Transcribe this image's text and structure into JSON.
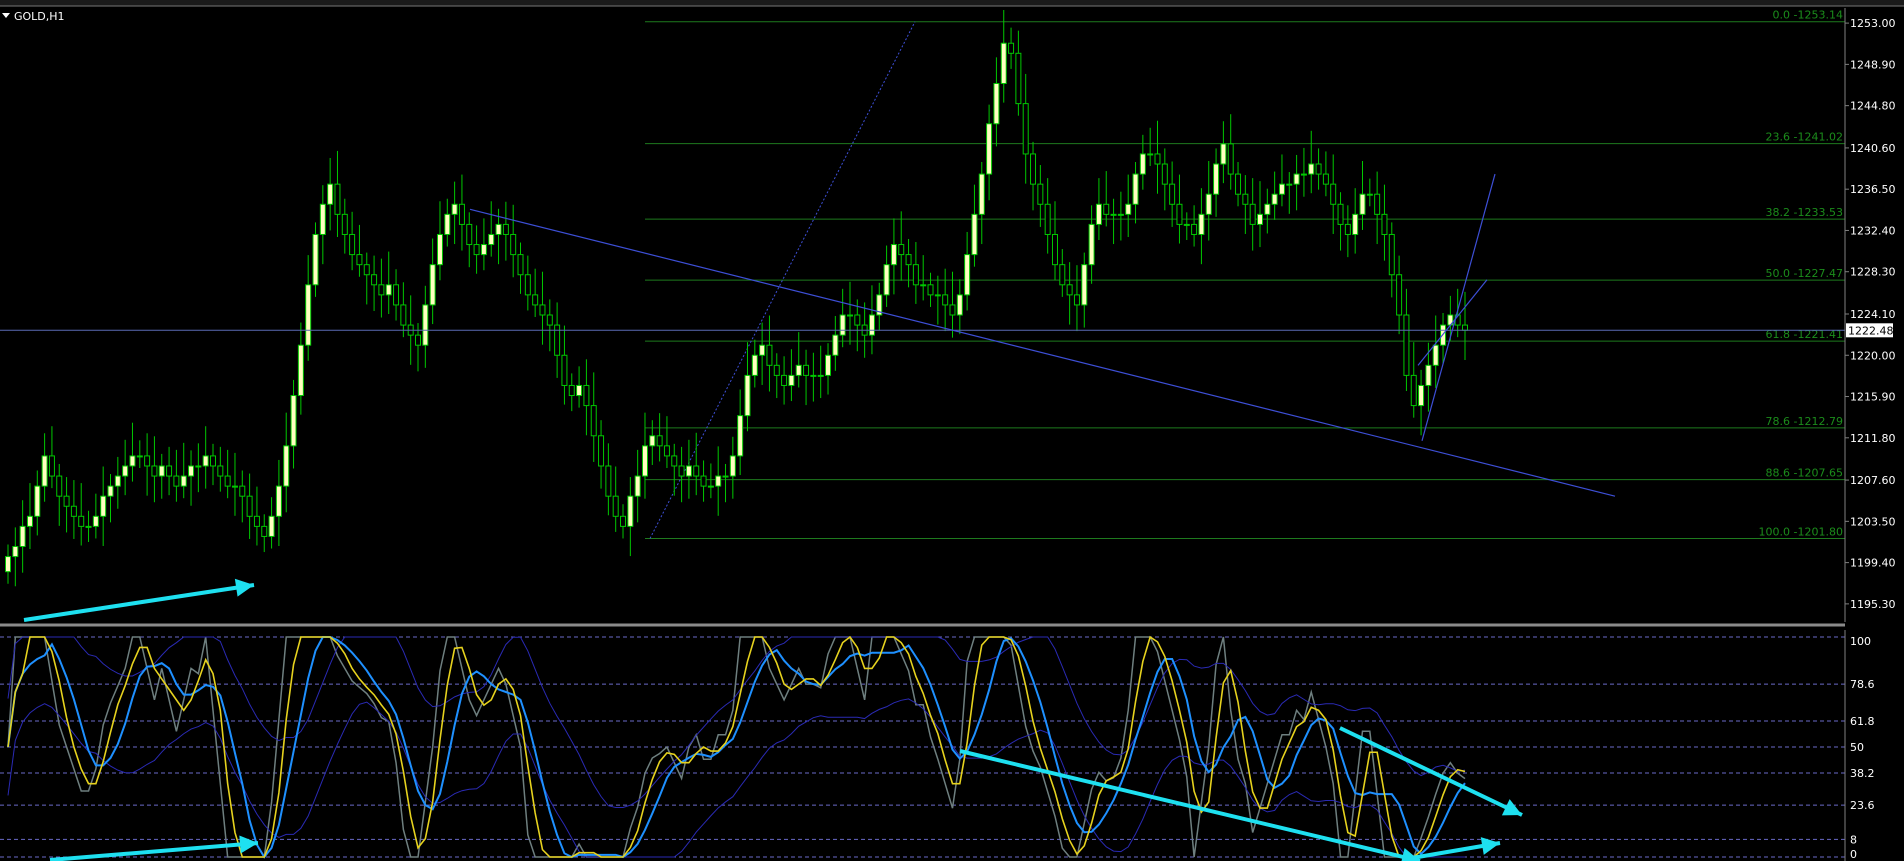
{
  "window": {
    "symbol_timeframe": "GOLD,H1"
  },
  "colors": {
    "background": "#000000",
    "bull_candle": "#ffffc0",
    "bear_candle": "#000000",
    "wick": "#00c800",
    "fib_line": "#1e7a1e",
    "fib_text": "#1b8c1b",
    "trendline": "#3d4fd6",
    "annotation_arrow": "#1ee0f0",
    "osc_main": "#e6d21e",
    "osc_signal": "#1e90ff",
    "osc_grey": "#6e7f7f",
    "osc_band": "#2a2ab4",
    "level_line": "#6a6ac8",
    "price_tag_bg": "#ffffff"
  },
  "chart_data": [
    {
      "type": "candlestick",
      "title": "GOLD,H1",
      "ylim": [
        1193.5,
        1254.5
      ],
      "y_ticks": [
        "1253.00",
        "1248.90",
        "1244.80",
        "1240.60",
        "1236.50",
        "1232.40",
        "1228.30",
        "1224.10",
        "1220.00",
        "1215.90",
        "1211.80",
        "1207.60",
        "1203.50",
        "1199.40",
        "1195.30"
      ],
      "current_price": "1222.48",
      "fibonacci_levels": [
        {
          "label": "0.0 -1253.14",
          "price": 1253.14
        },
        {
          "label": "23.6 -1241.02",
          "price": 1241.02
        },
        {
          "label": "38.2 -1233.53",
          "price": 1233.53
        },
        {
          "label": "50.0 -1227.47",
          "price": 1227.47
        },
        {
          "label": "61.8 -1221.41",
          "price": 1221.41
        },
        {
          "label": "78.6 -1212.79",
          "price": 1212.79
        },
        {
          "label": "88.6 -1207.65",
          "price": 1207.65
        },
        {
          "label": "100.0 -1201.80",
          "price": 1201.8
        }
      ],
      "closes": [
        1200,
        1201,
        1203,
        1204,
        1207,
        1210,
        1208,
        1206,
        1205,
        1204,
        1203,
        1203,
        1204,
        1206,
        1207,
        1208,
        1209,
        1210,
        1210,
        1209,
        1208,
        1209,
        1208,
        1207,
        1208,
        1209,
        1209,
        1210,
        1209,
        1208,
        1207,
        1207,
        1206,
        1204,
        1203,
        1202,
        1204,
        1207,
        1211,
        1216,
        1221,
        1227,
        1232,
        1235,
        1237,
        1234,
        1232,
        1230,
        1229,
        1228,
        1227,
        1226,
        1227,
        1225,
        1223,
        1222,
        1221,
        1225,
        1229,
        1232,
        1234,
        1235,
        1233,
        1231,
        1230,
        1231,
        1232,
        1233,
        1232,
        1230,
        1228,
        1226,
        1225,
        1224,
        1223,
        1220,
        1217,
        1216,
        1217,
        1215,
        1212,
        1209,
        1206,
        1204,
        1203,
        1206,
        1208,
        1211,
        1212,
        1211,
        1210,
        1209,
        1208,
        1209,
        1208,
        1207,
        1207,
        1208,
        1208,
        1210,
        1214,
        1218,
        1220,
        1221,
        1219,
        1218,
        1217,
        1218,
        1219,
        1218,
        1218,
        1218,
        1220,
        1222,
        1224,
        1224,
        1223,
        1222,
        1224,
        1226,
        1229,
        1231,
        1230,
        1229,
        1227,
        1227,
        1226,
        1226,
        1225,
        1224,
        1226,
        1230,
        1234,
        1238,
        1243,
        1247,
        1251,
        1250,
        1245,
        1240,
        1237,
        1235,
        1232,
        1229,
        1227,
        1226,
        1225,
        1229,
        1233,
        1235,
        1234,
        1234,
        1234,
        1235,
        1238,
        1240,
        1240,
        1239,
        1237,
        1235,
        1233,
        1233,
        1232,
        1234,
        1236,
        1239,
        1241,
        1238,
        1236,
        1235,
        1233,
        1234,
        1235,
        1236,
        1237,
        1237,
        1238,
        1238,
        1239,
        1238,
        1237,
        1235,
        1233,
        1232,
        1234,
        1236,
        1236,
        1234,
        1232,
        1228,
        1224,
        1218,
        1215,
        1217,
        1219,
        1221,
        1223,
        1224,
        1223,
        1222.48
      ]
    },
    {
      "type": "line",
      "ylim": [
        0,
        100
      ],
      "y_ticks": [
        "100",
        "78.6",
        "61.8",
        "50",
        "38.2",
        "23.6",
        "8",
        "0"
      ],
      "levels": [
        100,
        78.6,
        61.8,
        50,
        38.2,
        23.6,
        8,
        0
      ]
    }
  ]
}
